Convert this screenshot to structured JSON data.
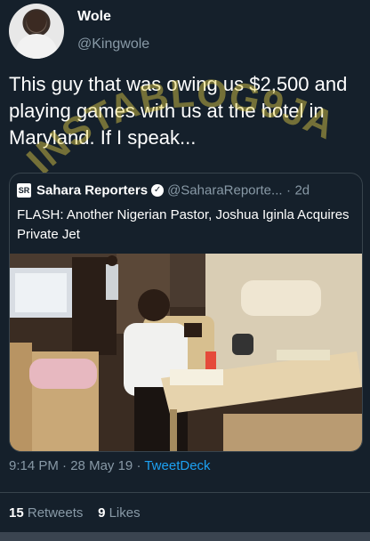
{
  "author": {
    "display_name": "Wole",
    "handle": "@Kingwole"
  },
  "tweet": {
    "text": "This guy that was owing us $2,500 and playing games with us at the hotel in Maryland. If I speak...",
    "time": "9:14 PM",
    "separator": "·",
    "date": "28 May 19",
    "source": "TweetDeck"
  },
  "watermark": {
    "text": "INSTABLOG9JA"
  },
  "quoted_tweet": {
    "logo_text": "SR",
    "display_name": "Sahara Reporters",
    "handle": "@SaharaReporte...",
    "separator": "·",
    "age": "2d",
    "text": "FLASH: Another Nigerian Pastor, Joshua Iginla Acquires Private Jet"
  },
  "stats": {
    "retweets_count": "15",
    "retweets_label": "Retweets",
    "likes_count": "9",
    "likes_label": "Likes"
  },
  "colors": {
    "background": "#15202b",
    "secondary_text": "#8899a6",
    "link": "#1da1f2",
    "watermark": "#e8d24a"
  }
}
